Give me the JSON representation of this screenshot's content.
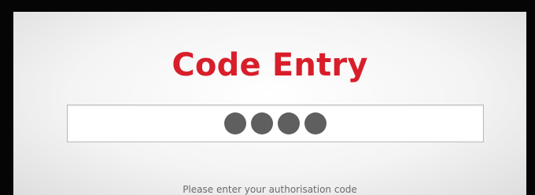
{
  "screen": {
    "title": "Code Entry",
    "title_color": "#d81e2a"
  },
  "code_entry": {
    "masked_value": "••••",
    "digits_entered": 4,
    "hint": "Please enter your authorisation code"
  }
}
